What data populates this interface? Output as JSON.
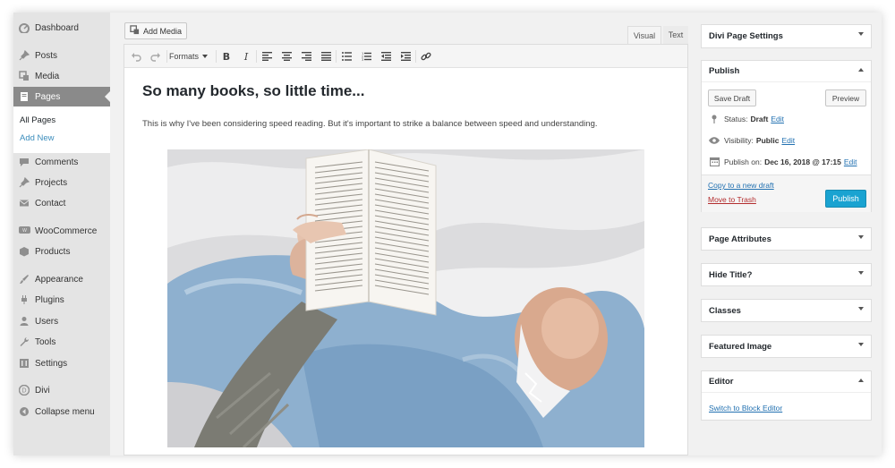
{
  "sidebar": {
    "items": [
      {
        "label": "Dashboard",
        "icon": "dashboard-icon"
      },
      {
        "label": "Posts",
        "icon": "pin-icon"
      },
      {
        "label": "Media",
        "icon": "media-icon"
      },
      {
        "label": "Pages",
        "icon": "page-icon",
        "active": true
      },
      {
        "label": "Comments",
        "icon": "comment-icon"
      },
      {
        "label": "Projects",
        "icon": "pin-icon"
      },
      {
        "label": "Contact",
        "icon": "mail-icon"
      },
      {
        "label": "WooCommerce",
        "icon": "woo-icon"
      },
      {
        "label": "Products",
        "icon": "box-icon"
      },
      {
        "label": "Appearance",
        "icon": "brush-icon"
      },
      {
        "label": "Plugins",
        "icon": "plug-icon"
      },
      {
        "label": "Users",
        "icon": "user-icon"
      },
      {
        "label": "Tools",
        "icon": "wrench-icon"
      },
      {
        "label": "Settings",
        "icon": "settings-icon"
      },
      {
        "label": "Divi",
        "icon": "divi-icon"
      },
      {
        "label": "Collapse menu",
        "icon": "collapse-icon"
      }
    ],
    "submenu": [
      {
        "label": "All Pages",
        "current": true
      },
      {
        "label": "Add New",
        "current": false
      }
    ]
  },
  "editor": {
    "add_media_label": "Add Media",
    "tab_visual": "Visual",
    "tab_text": "Text",
    "formats_label": "Formats",
    "title": "So many books, so little time...",
    "paragraph": "This is why I've been considering speed reading. But it's important to strike a balance between speed and understanding."
  },
  "right": {
    "divi_settings": "Divi Page Settings",
    "publish": {
      "title": "Publish",
      "save_draft": "Save Draft",
      "preview": "Preview",
      "status_label": "Status:",
      "status_value": "Draft",
      "visibility_label": "Visibility:",
      "visibility_value": "Public",
      "publish_on_label": "Publish on:",
      "publish_on_value": "Dec 16, 2018 @ 17:15",
      "edit_label": "Edit",
      "copy_draft": "Copy to a new draft",
      "move_trash": "Move to Trash",
      "publish_button": "Publish"
    },
    "page_attributes": "Page Attributes",
    "hide_title": "Hide Title?",
    "classes": "Classes",
    "featured_image": "Featured Image",
    "editor_box": {
      "title": "Editor",
      "switch_link": "Switch to Block Editor"
    }
  },
  "colors": {
    "sidebar_bg": "#e4e4e4",
    "active_item": "#8a8a8a",
    "link": "#2271b1",
    "trash": "#b32d2e",
    "publish_btn": "#1aa3d1"
  }
}
